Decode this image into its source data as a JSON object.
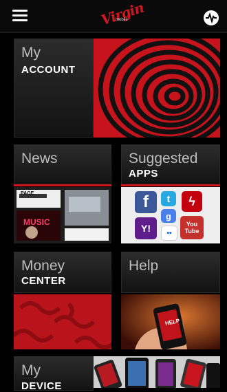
{
  "header": {
    "logo_text": "Virgin",
    "logo_sub": "mobile"
  },
  "tiles": {
    "account": {
      "line1": "My",
      "line2": "ACCOUNT"
    },
    "news": {
      "line1": "News"
    },
    "apps": {
      "line1": "Suggested",
      "line2": "APPS"
    },
    "money": {
      "line1": "Money",
      "line2": "CENTER"
    },
    "help": {
      "line1": "Help"
    },
    "device": {
      "line1": "My",
      "line2": "DEVICE"
    }
  },
  "news_thumb": {
    "headline_tag": "MUSIC",
    "top_tag": "PAGE"
  },
  "apps_thumb": {
    "icons": [
      {
        "name": "facebook-icon",
        "glyph": "f",
        "color": "#3b5998"
      },
      {
        "name": "twitter-icon",
        "glyph": "t",
        "color": "#29a9e1"
      },
      {
        "name": "lastfm-icon",
        "glyph": "ϟ",
        "color": "#c3000d"
      },
      {
        "name": "google-icon",
        "glyph": "g",
        "color": "#4a7ee8"
      },
      {
        "name": "yahoo-icon",
        "glyph": "Y!",
        "color": "#5f1d8c"
      },
      {
        "name": "flickr-icon",
        "glyph": "••",
        "color": "#ffffff"
      },
      {
        "name": "youtube-icon",
        "glyph": "You Tube",
        "color": "#c4302b"
      }
    ]
  },
  "help_thumb": {
    "screen_text": "HELP"
  }
}
